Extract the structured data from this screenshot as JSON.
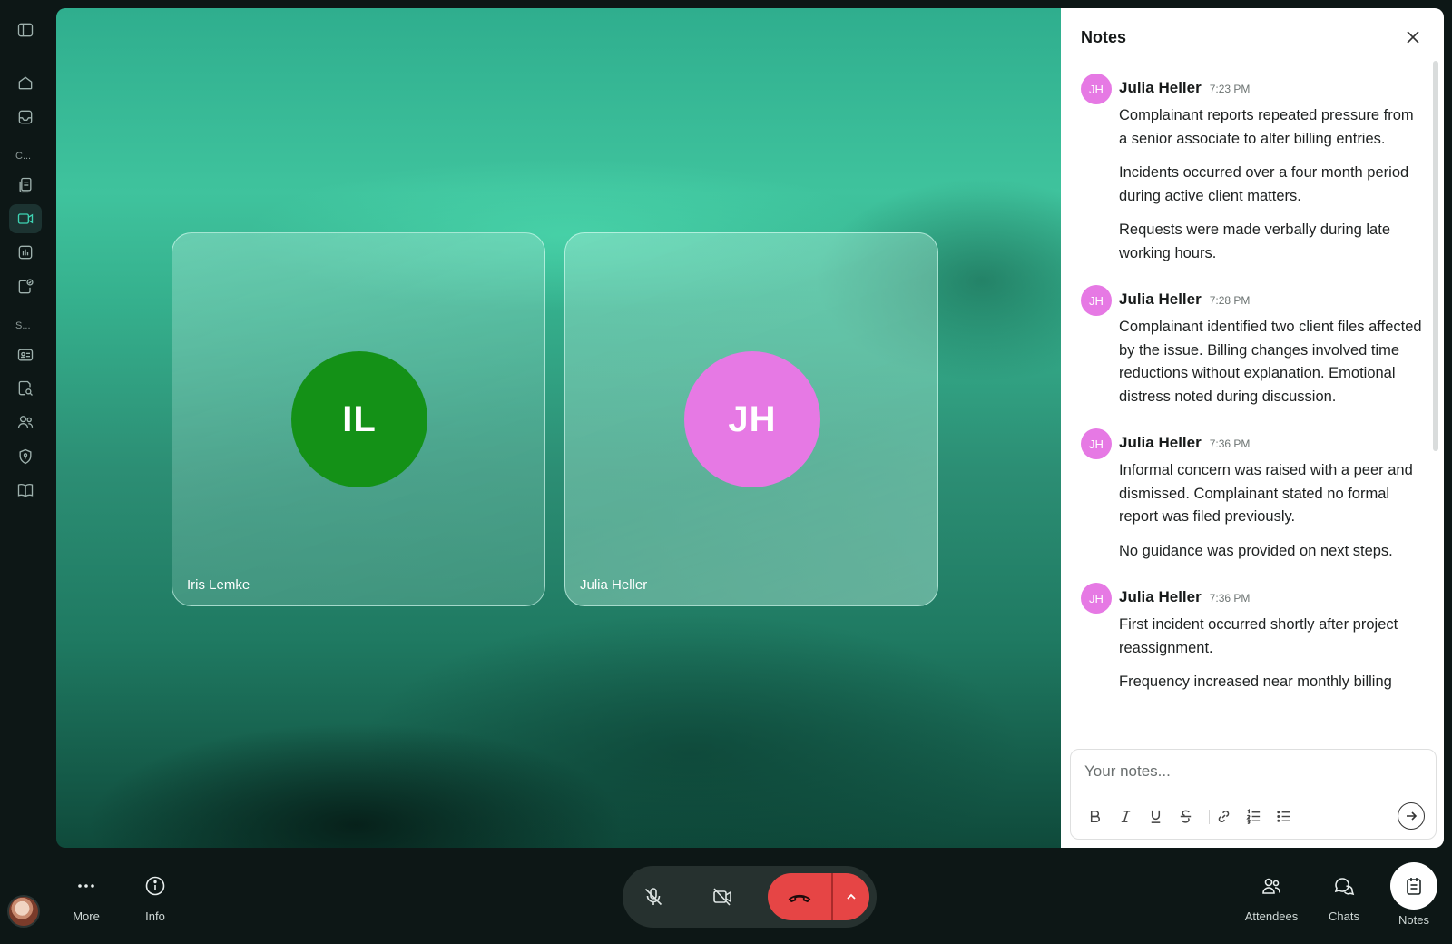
{
  "sidebar": {
    "section1": "C...",
    "section2": "S...",
    "items": [
      {
        "icon": "sidebar-toggle-icon"
      },
      {
        "icon": "home-icon"
      },
      {
        "icon": "inbox-icon"
      },
      {
        "icon": "documents-icon"
      },
      {
        "icon": "video-call-icon",
        "active": true
      },
      {
        "icon": "analytics-icon"
      },
      {
        "icon": "verified-file-icon"
      },
      {
        "icon": "id-card-icon"
      },
      {
        "icon": "search-document-icon"
      },
      {
        "icon": "users-icon"
      },
      {
        "icon": "shield-icon"
      },
      {
        "icon": "book-icon"
      }
    ]
  },
  "participants": [
    {
      "initials": "IL",
      "name": "Iris Lemke",
      "color": "#149117"
    },
    {
      "initials": "JH",
      "name": "Julia Heller",
      "color": "#e679e4"
    }
  ],
  "notes_panel": {
    "title": "Notes",
    "notes": [
      {
        "avatar": "JH",
        "author": "Julia Heller",
        "time": "7:23 PM",
        "paragraphs": [
          "Complainant reports repeated pressure from a senior associate to alter billing entries.",
          "Incidents occurred over a four month period during active client matters.",
          "Requests were made verbally during late working hours."
        ]
      },
      {
        "avatar": "JH",
        "author": "Julia Heller",
        "time": "7:28 PM",
        "paragraphs": [
          "Complainant identified two client files affected by the issue. Billing changes involved time reductions without explanation. Emotional distress noted during discussion."
        ]
      },
      {
        "avatar": "JH",
        "author": "Julia Heller",
        "time": "7:36 PM",
        "paragraphs": [
          "Informal concern was raised with a peer and dismissed. Complainant stated no formal report was filed previously.",
          "No guidance was provided on next steps."
        ]
      },
      {
        "avatar": "JH",
        "author": "Julia Heller",
        "time": "7:36 PM",
        "paragraphs": [
          "First incident occurred shortly after project reassignment.",
          "Frequency increased near monthly billing"
        ]
      }
    ],
    "composer": {
      "placeholder": "Your notes...",
      "tools": [
        "bold-icon",
        "italic-icon",
        "underline-icon",
        "strikethrough-icon",
        "link-icon",
        "ordered-list-icon",
        "bullet-list-icon"
      ]
    }
  },
  "bottom_bar": {
    "more_label": "More",
    "info_label": "Info",
    "attendees_label": "Attendees",
    "chats_label": "Chats",
    "notes_label": "Notes",
    "hangup_color": "#e64545"
  }
}
